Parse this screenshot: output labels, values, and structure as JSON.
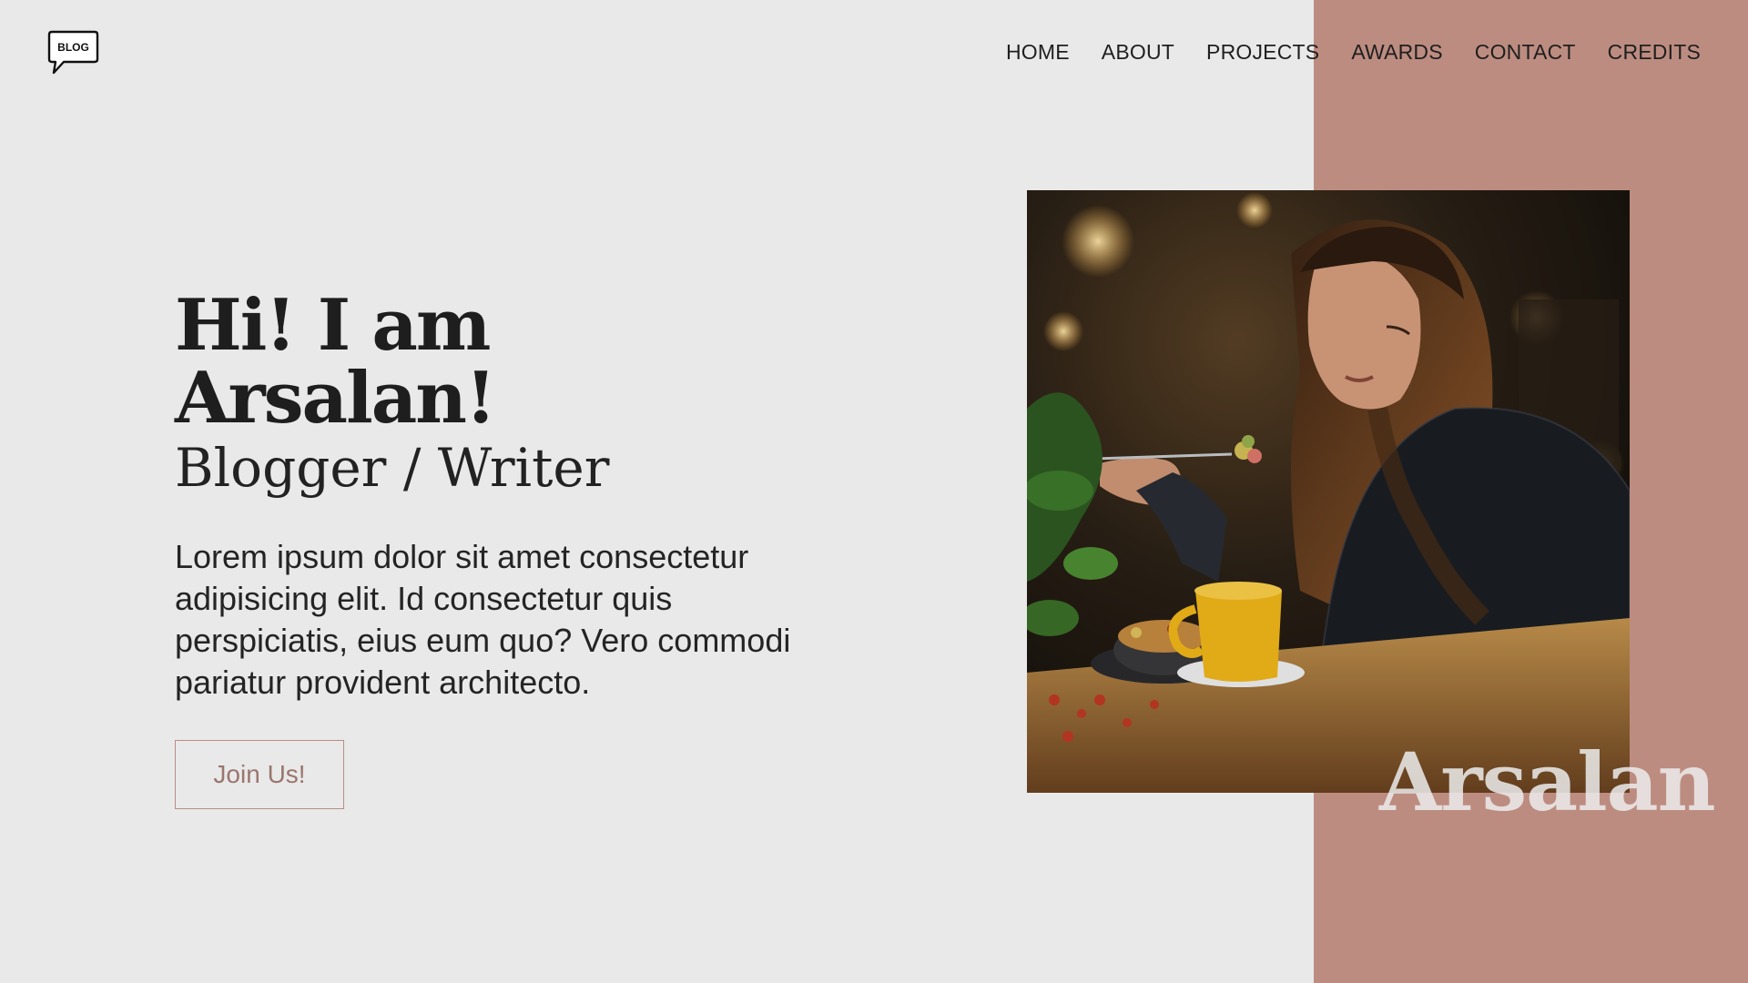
{
  "brand": {
    "logo_text": "BLOG"
  },
  "nav": {
    "items": [
      {
        "label": "HOME"
      },
      {
        "label": "ABOUT"
      },
      {
        "label": "PROJECTS"
      },
      {
        "label": "AWARDS"
      },
      {
        "label": "CONTACT"
      },
      {
        "label": "CREDITS"
      }
    ]
  },
  "hero": {
    "title": "Hi! I am Arsalan!",
    "subtitle": "Blogger / Writer",
    "body": "Lorem ipsum dolor sit amet consectetur adipisicing elit. Id consectetur quis perspiciatis, eius eum quo? Vero commodi pariatur provident architecto.",
    "cta_label": "Join Us!"
  },
  "feature": {
    "watermark": "Arsalan"
  },
  "colors": {
    "background": "#e9e9e9",
    "accent": "#bd8c80",
    "text": "#1f1f1f",
    "button_border": "#b78e84",
    "button_text": "#9a766e"
  },
  "icons": {
    "logo": "speech-bubble-blog-icon"
  }
}
